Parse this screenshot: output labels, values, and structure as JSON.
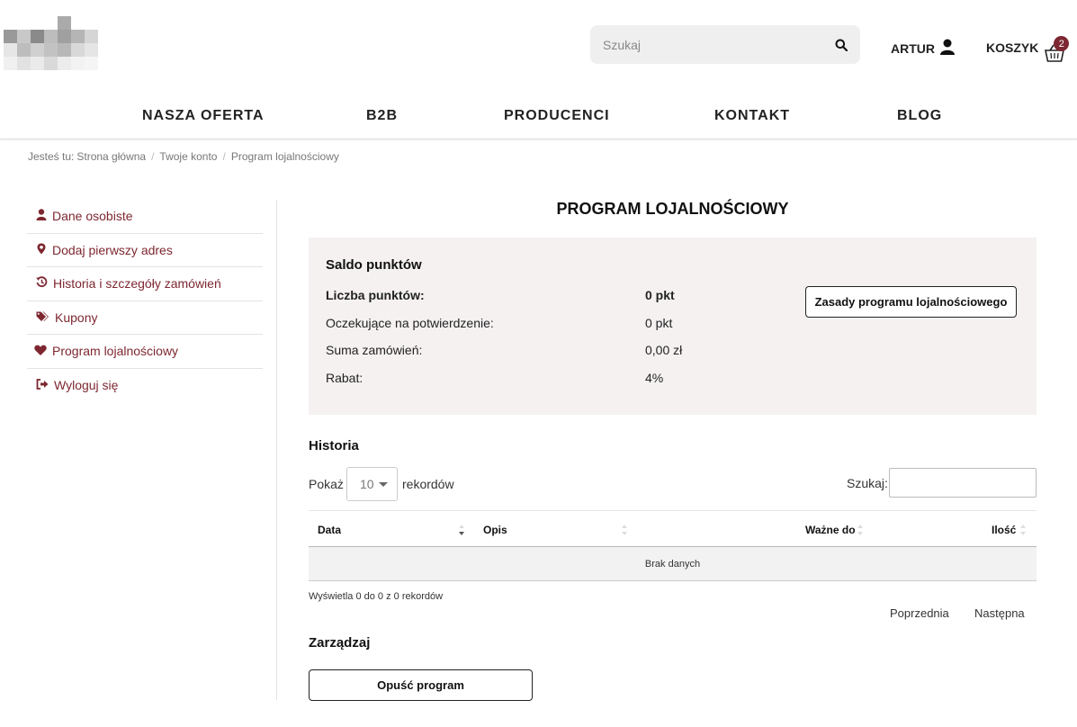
{
  "header": {
    "search_placeholder": "Szukaj",
    "account_label": "ARTUR",
    "cart_label": "KOSZYK",
    "cart_count": "2"
  },
  "nav": {
    "items": [
      "NASZA OFERTA",
      "B2B",
      "PRODUCENCI",
      "KONTAKT",
      "BLOG"
    ]
  },
  "breadcrumb": {
    "prefix": "Jesteś tu:",
    "items": [
      "Strona główna",
      "Twoje konto",
      "Program lojalnościowy"
    ],
    "separator": "/"
  },
  "sidebar": {
    "items": [
      {
        "label": "Dane osobiste",
        "icon": "user-icon"
      },
      {
        "label": "Dodaj pierwszy adres",
        "icon": "map-marker-icon"
      },
      {
        "label": "Historia i szczegóły zamówień",
        "icon": "history-icon"
      },
      {
        "label": "Kupony",
        "icon": "tags-icon"
      },
      {
        "label": "Program lojalnościowy",
        "icon": "heart-icon"
      },
      {
        "label": "Wyloguj się",
        "icon": "sign-out-icon"
      }
    ]
  },
  "main": {
    "title": "PROGRAM LOJALNOŚCIOWY",
    "points": {
      "heading": "Saldo punktów",
      "rows": [
        {
          "label": "Liczba punktów:",
          "value": "0 pkt"
        },
        {
          "label": "Oczekujące na potwierdzenie:",
          "value": "0 pkt"
        },
        {
          "label": "Suma zamówień:",
          "value": "0,00 zł"
        },
        {
          "label": "Rabat:",
          "value": "4%"
        }
      ],
      "rules_button": "Zasady programu lojalnościowego"
    },
    "history": {
      "heading": "Historia",
      "show_label": "Pokaż",
      "page_size": "10",
      "records_label": "rekordów",
      "search_label": "Szukaj:",
      "columns": [
        "Data",
        "Opis",
        "Ważne do",
        "Ilość"
      ],
      "empty_text": "Brak danych",
      "info": "Wyświetla 0 do 0 z 0 rekordów",
      "prev_label": "Poprzednia",
      "next_label": "Następna"
    },
    "manage": {
      "heading": "Zarządzaj",
      "leave_button": "Opuść program"
    }
  },
  "colors": {
    "accent": "#7d2730",
    "panel_bg": "#f5f1f1"
  }
}
